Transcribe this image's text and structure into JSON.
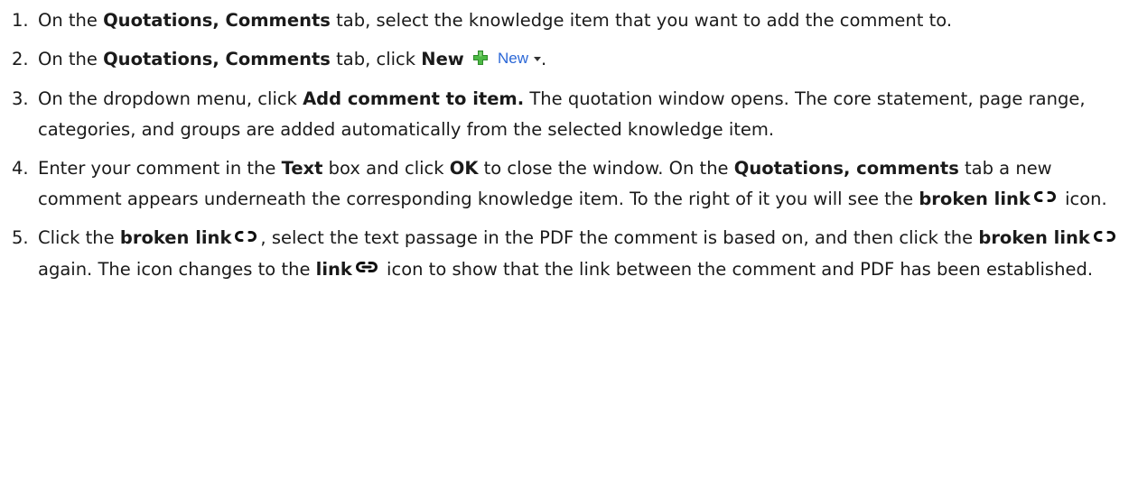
{
  "steps": [
    {
      "num": "1.",
      "t1": "On the ",
      "b1": "Quotations, Comments",
      "t2": " tab, select the knowledge item that you want to add the comment to."
    },
    {
      "num": "2.",
      "t1": "On the ",
      "b1": "Quotations, Comments",
      "t2": " tab, click ",
      "b2": "New",
      "new_label": "New",
      "t3": "."
    },
    {
      "num": "3.",
      "t1": "On the dropdown menu, click ",
      "b1": "Add comment to item.",
      "t2": " The quotation window opens. The core statement, page range, categories, and groups are added automatically from the selected knowledge item."
    },
    {
      "num": "4.",
      "t1": "Enter your comment in the ",
      "b1": "Text",
      "t2": " box and click ",
      "b2": "OK",
      "t3": " to close the window. On the ",
      "b3": "Quotations, comments",
      "t4": " tab a new comment appears underneath the corresponding knowledge item. To the right of it you will see the ",
      "b4": "broken link",
      "t5": " icon."
    },
    {
      "num": "5.",
      "t1": "Click the ",
      "b1": "broken link",
      "t2": ", select the text passage in the PDF the comment is based on, and then click the ",
      "b2": "broken link",
      "t3": " again. The icon changes to the ",
      "b3": "link",
      "t4": " icon to show that the link between the comment and PDF has been established."
    }
  ],
  "icons": {
    "new": "green-plus-icon",
    "broken_link": "broken-link-icon",
    "link": "link-icon"
  },
  "colors": {
    "text": "#1a1a1a",
    "plus_green": "#3aa635",
    "new_label_blue": "#2b67d6"
  }
}
